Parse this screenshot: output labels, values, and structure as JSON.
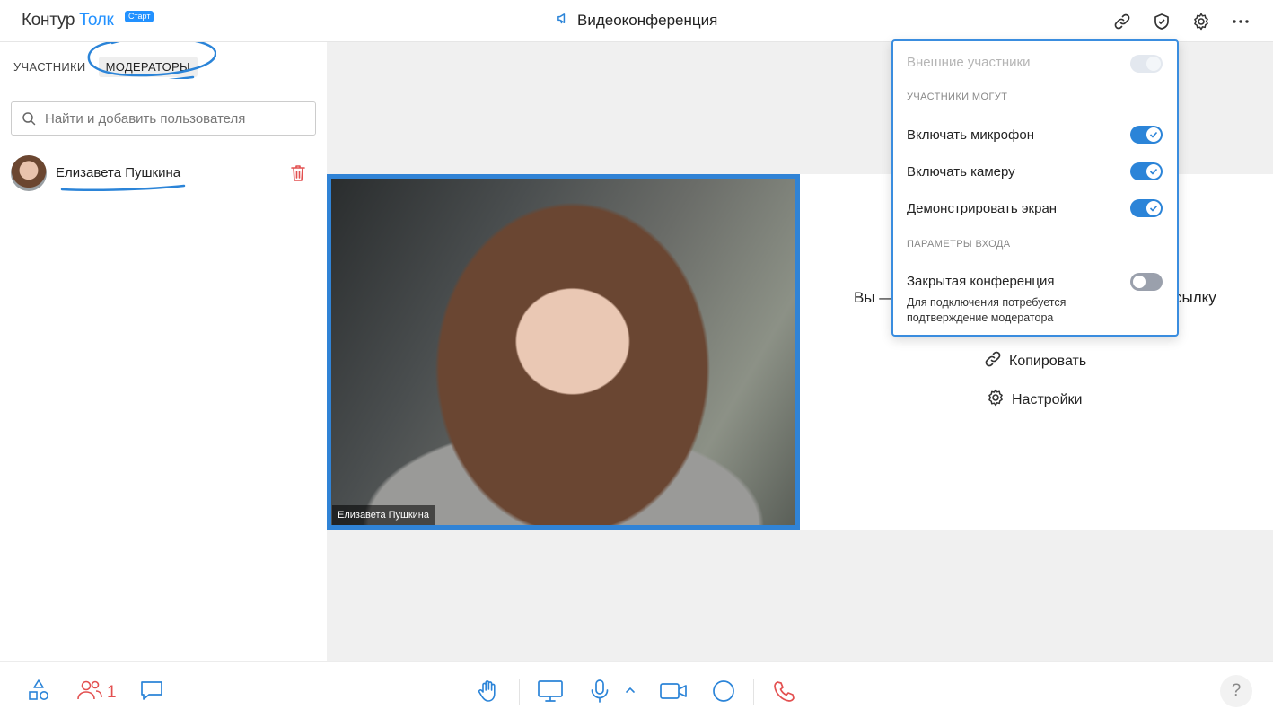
{
  "header": {
    "brand": "Контур",
    "product": "Толк",
    "plan_badge": "Старт",
    "conference_title": "Видеоконференция",
    "icons": [
      "megaphone-icon",
      "link-icon",
      "shield-check-icon",
      "gear-icon",
      "more-dots-icon"
    ]
  },
  "sidebar": {
    "tabs": [
      {
        "label": "УЧАСТНИКИ",
        "active": false
      },
      {
        "label": "МОДЕРАТОРЫ",
        "active": true
      }
    ],
    "search": {
      "placeholder": "Найти и добавить пользователя"
    },
    "moderators": [
      {
        "name": "Елизавета Пушкина"
      }
    ]
  },
  "main": {
    "video_tile": {
      "name_label": "Елизавета Пушкина"
    },
    "invite": {
      "text_left": "Вы —",
      "text_right": "сылку",
      "copy_label": "Копировать",
      "settings_label": "Настройки"
    }
  },
  "popup": {
    "external_participants": {
      "label": "Внешние участники",
      "state": "disabled-on"
    },
    "section_participants_can": "УЧАСТНИКИ МОГУТ",
    "toggles": [
      {
        "label": "Включать микрофон",
        "on": true
      },
      {
        "label": "Включать камеру",
        "on": true
      },
      {
        "label": "Демонстрировать экран",
        "on": true
      }
    ],
    "section_entry_params": "ПАРАМЕТРЫ ВХОДА",
    "closed_conference": {
      "label": "Закрытая конференция",
      "on": false,
      "description": "Для подключения потребуется подтверждение модератора"
    }
  },
  "bottom_bar": {
    "participants_count": "1",
    "help_label": "?",
    "colors": {
      "accent": "#2b84d8",
      "danger": "#e35050"
    }
  }
}
